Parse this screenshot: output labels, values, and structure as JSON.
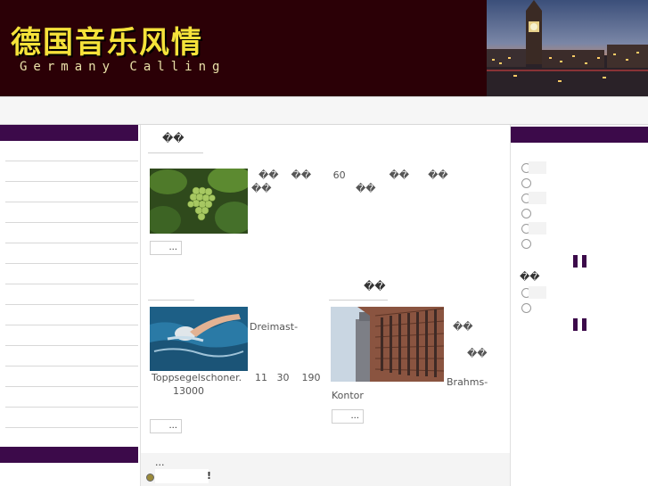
{
  "header": {
    "logo_cn": "德国音乐风情",
    "logo_en": "Germany Calling"
  },
  "main": {
    "section1": {
      "title": "��",
      "text_line1": "��    ��       60              ��      ��",
      "text_line2": "��                           ��",
      "more_label": "..."
    },
    "section2": {
      "title": "",
      "caption_a": "Dreimast-",
      "caption_b": "Toppsegelschoner.",
      "caption_c": "11   30    190",
      "caption_d": "13000",
      "more_label": "..."
    },
    "section3": {
      "title": "��",
      "caption_a": "��",
      "caption_b": "��",
      "caption_c": "Brahms-",
      "caption_d": "Kontor",
      "more_label": "..."
    },
    "footer_ellipsis": "...",
    "footer_excl": "!"
  },
  "sidebar_right": {
    "subtitle": "��"
  }
}
